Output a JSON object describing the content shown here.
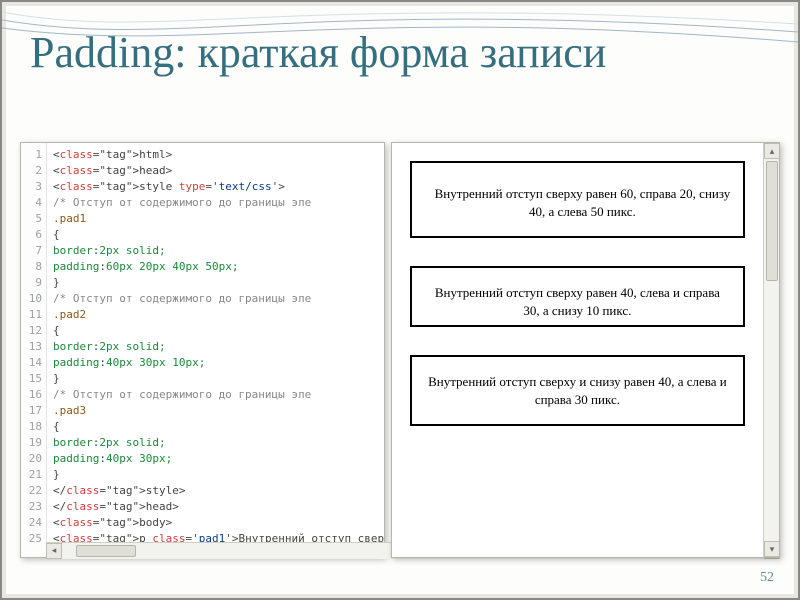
{
  "title": "Padding: краткая форма записи",
  "page_number": "52",
  "code_lines": [
    "<html>",
    "<head>",
    "<style type='text/css'>",
    "/* Отступ от содержимого до границы эле",
    ".pad1",
    "{",
    "border:2px solid;",
    "padding:60px 20px 40px 50px;",
    "}",
    "/* Отступ от содержимого до границы эле",
    ".pad2",
    "{",
    "border:2px solid;",
    "padding:40px 30px 10px;",
    "}",
    "/* Отступ от содержимого до границы эле",
    ".pad3",
    "{",
    "border:2px solid;",
    "padding:40px 30px;",
    "}",
    "</style>",
    "</head>",
    "<body>",
    "<p class='pad1'>Внутренний отступ свер"
  ],
  "preview": {
    "box1": "Внутренний отступ сверху равен 60, справа 20, снизу 40, а слева 50 пикс.",
    "box2": "Внутренний отступ сверху равен 40, слева и справа 30, а снизу 10 пикс.",
    "box3": "Внутренний отступ сверху и снизу равен 40, а слева и справа 30 пикс."
  }
}
